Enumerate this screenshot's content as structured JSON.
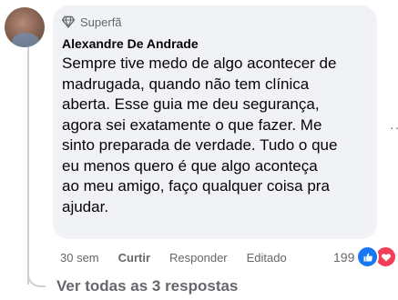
{
  "comment": {
    "badge_label": "Superfã",
    "author": "Alexandre De Andrade",
    "text_lines": [
      "Sempre tive medo de algo acontecer de",
      "madrugada, quando não tem clínica",
      "aberta. Esse guia me deu segurança,",
      "agora sei exatamente o que fazer. Me",
      "sinto preparada de verdade. Tudo o que",
      "eu menos quero é que algo aconteça",
      "ao meu amigo, faço qualquer coisa pra",
      "ajudar."
    ]
  },
  "actions": {
    "time": "30 sem",
    "like": "Curtir",
    "reply": "Responder",
    "edited": "Editado"
  },
  "reactions": {
    "count": "199",
    "icons": [
      "like-icon",
      "love-icon"
    ]
  },
  "replies": {
    "view_label": "Ver todas as 3 respostas"
  },
  "colors": {
    "bubble": "#f0f2f5",
    "like": "#1877f2",
    "love": "#f33e58",
    "muted": "#65676b"
  }
}
